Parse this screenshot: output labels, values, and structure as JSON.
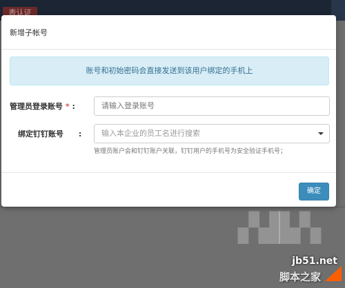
{
  "background": {
    "tag_label": "表认证"
  },
  "modal": {
    "title": "新增子帐号",
    "alert_text": "账号和初始密码会直接发送到该用户绑定的手机上",
    "fields": [
      {
        "label": "管理员登录账号",
        "required_mark": "*",
        "colon": ":",
        "placeholder": "请输入登录账号",
        "value": ""
      },
      {
        "label": "绑定钉钉账号",
        "colon": ":",
        "selected_text": "输入本企业的员工名进行搜索",
        "help": "管理员账户会和钉钉账户关联，钉钉用户的手机号为安全验证手机号；"
      }
    ],
    "confirm_label": "确定"
  },
  "watermark": {
    "site": "jb51.net",
    "name": "脚本之家"
  },
  "colors": {
    "primary": "#3c8dbc",
    "alert_bg": "#d9edf7",
    "alert_text": "#31708f",
    "required": "#d9534f"
  }
}
